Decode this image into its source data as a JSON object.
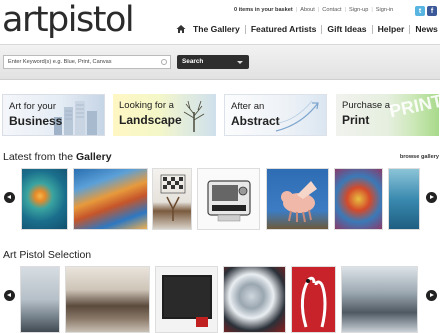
{
  "header": {
    "logo": "artpistol",
    "basket": "0 items in your basket",
    "links": [
      "About",
      "Contact",
      "Sign-up",
      "Sign-in"
    ],
    "nav": [
      "The Gallery",
      "Featured Artists",
      "Gift Ideas",
      "Helper",
      "News"
    ]
  },
  "search": {
    "placeholder": "Enter Keyword(s) e.g. Blue, Print, Canvas",
    "button": "Search"
  },
  "categories": [
    {
      "line1": "Art for your",
      "line2": "Business"
    },
    {
      "line1": "Looking for a",
      "line2": "Landscape"
    },
    {
      "line1": "After an",
      "line2": "Abstract"
    },
    {
      "line1": "Purchase a",
      "line2": "Print"
    }
  ],
  "category_watermark": "PRINT",
  "gallery": {
    "title_prefix": "Latest from the ",
    "title_bold": "Gallery",
    "browse": "browse gallery"
  },
  "selection": {
    "title": "Art Pistol Selection"
  },
  "icons": {
    "home": "home-icon",
    "twitter": "twitter-icon",
    "facebook": "facebook-icon"
  }
}
